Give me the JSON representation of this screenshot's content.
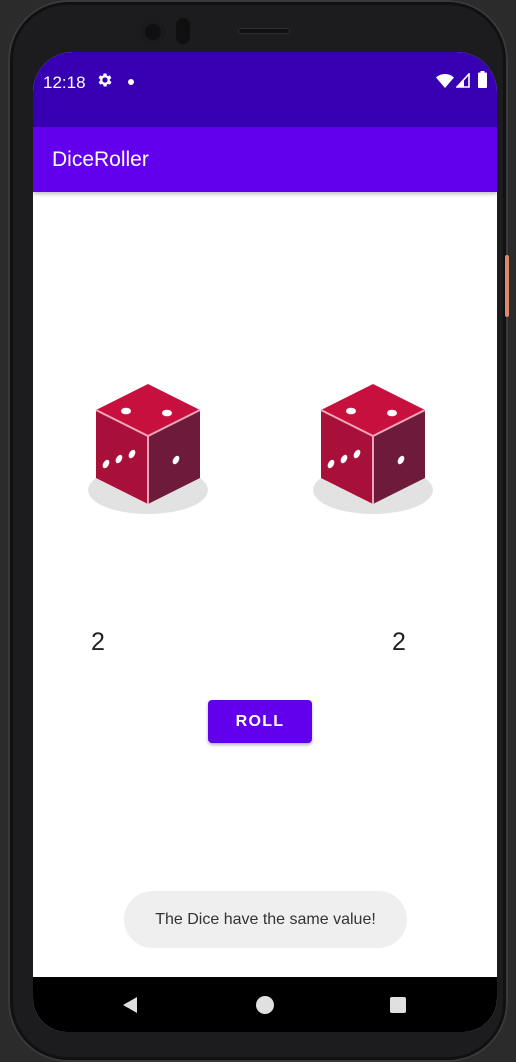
{
  "status_bar": {
    "time": "12:18",
    "icons": [
      "gear-icon",
      "notification-dot-icon",
      "wifi-icon",
      "signal-icon",
      "battery-icon"
    ]
  },
  "app_bar": {
    "title": "DiceRoller"
  },
  "dice": [
    {
      "value": "2",
      "icon": "dice-icon"
    },
    {
      "value": "2",
      "icon": "dice-icon"
    }
  ],
  "roll_button": {
    "label": "ROLL"
  },
  "toast": {
    "message": "The Dice have the same value!"
  },
  "nav_bar": {
    "icons": [
      "back-icon",
      "home-icon",
      "recents-icon"
    ]
  },
  "colors": {
    "primary": "#6200ee",
    "primary_dark": "#3700b3",
    "die_top": "#c8103e",
    "die_left": "#a81039",
    "die_right": "#6e1a3a"
  }
}
